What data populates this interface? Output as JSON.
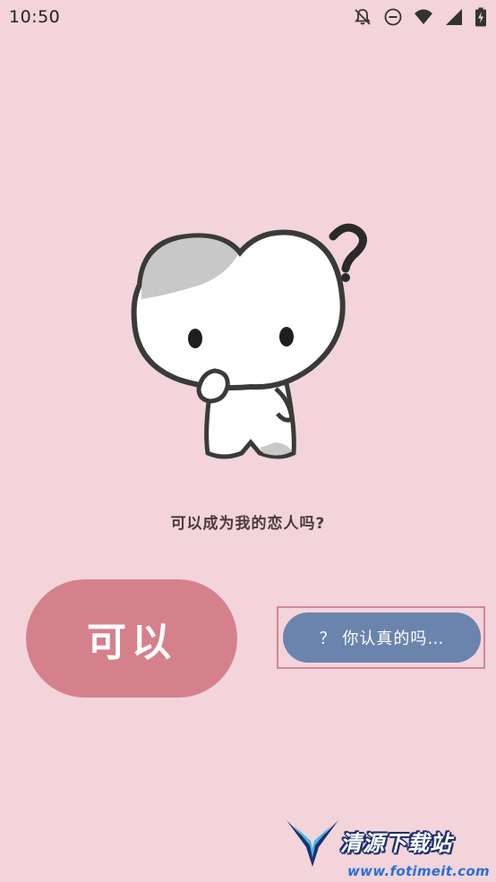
{
  "status_bar": {
    "time": "10:50",
    "icons": [
      "notifications-off-icon",
      "do-not-disturb-icon",
      "wifi-icon",
      "signal-icon",
      "battery-charging-icon"
    ]
  },
  "main": {
    "question": "可以成为我的恋人吗?",
    "yes_button_label": "可以",
    "no_button_label": "？ 你认真的吗…",
    "mascot": "thinking-mascot"
  },
  "watermark": {
    "name": "清源下载站",
    "url": "www.fotimeit.com"
  },
  "colors": {
    "background": "#f2d4da",
    "yes_button": "#d5818c",
    "no_button": "#6b84ad",
    "highlight_frame": "#d48795"
  }
}
